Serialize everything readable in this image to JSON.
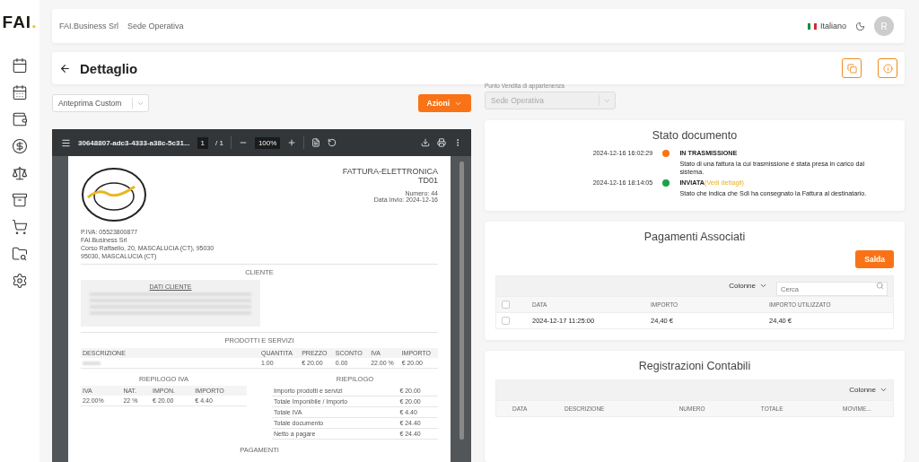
{
  "logo": {
    "text": "FAI",
    "dot": "."
  },
  "header": {
    "breadcrumbs": [
      "FAI.Business Srl",
      "Sede Operativa"
    ],
    "language": "Italiano",
    "avatar": "R"
  },
  "title": "Dettaglio",
  "preview_select": {
    "value": "Anteprima Custom"
  },
  "actions_button": "Azioni",
  "store_select": {
    "label": "Punto Vendita di appartenenza",
    "value": "Sede Operativa",
    "disabled": true
  },
  "pdf": {
    "file": "30648807-adc3-4333-a38c-5c31...",
    "page": "1",
    "pages": "/ 1",
    "zoom": "100%",
    "doc_type": "FATTURA-ELETTRONICA",
    "doc_code": "TD01",
    "number": "Numero: 44",
    "date": "Data Invio: 2024-12-16",
    "issuer": [
      "P.IVA: 05523800877",
      "FAI.Business Srl",
      "Corso Raffaello, 20, MASCALUCIA (CT), 95030",
      "95030, MASCALUCIA (CT)"
    ],
    "client_section": "CLIENTE",
    "client_title": "DATI CLIENTE",
    "products_section": "PRODOTTI E SERVIZI",
    "products_columns": [
      "DESCRIZIONE",
      "QUANTITA",
      "PREZZO",
      "SCONTO",
      "IVA",
      "IMPORTO"
    ],
    "products_rows": [
      [
        "1.00",
        "€ 20.00",
        "0.00",
        "22.00 %",
        "€ 20.00"
      ]
    ],
    "vat_section": "RIEPILOGO IVA",
    "vat_columns": [
      "IVA",
      "NAT.",
      "IMPON.",
      "IMPORTO"
    ],
    "vat_rows": [
      [
        "22.00%",
        "22 %",
        "€ 20.00",
        "€ 4.40"
      ]
    ],
    "summary_section": "RIEPILOGO",
    "summary_rows": [
      [
        "Importo prodotti e servizi",
        "€ 20.00"
      ],
      [
        "Totale Imponibile / Importo",
        "€ 20.00"
      ],
      [
        "Totale IVA",
        "€ 4.40"
      ],
      [
        "Totale documento",
        "€ 24.40"
      ],
      [
        "Netto a pagare",
        "€ 24.40"
      ]
    ],
    "payments_section": "PAGAMENTI"
  },
  "status": {
    "title": "Stato documento",
    "events": [
      {
        "time": "2024-12-16 16:02:29",
        "color": "#f97316",
        "title": "IN TRASMISSIONE",
        "description": "Stato di una fattura la cui trasmissione è stata presa in carico dal sistema."
      },
      {
        "time": "2024-12-16 18:14:05",
        "color": "#16a34a",
        "title": "INVIATA",
        "link": "(Vedi dettagli)",
        "description": "Stato che indica che SdI ha consegnato la Fattura al destinatario."
      }
    ]
  },
  "payments": {
    "title": "Pagamenti Associati",
    "button": "Salda",
    "columns_button": "Colonne",
    "search_placeholder": "Cerca",
    "select_all_checked": false,
    "columns": [
      "DATA",
      "IMPORTO",
      "IMPORTO UTILIZZATO"
    ],
    "rows": [
      {
        "checked": false,
        "cells": [
          "2024-12-17 11:25:00",
          "24,40 €",
          "24,40 €"
        ]
      }
    ]
  },
  "registrations": {
    "title": "Registrazioni Contabili",
    "columns_button": "Colonne",
    "columns": [
      "DATA",
      "DESCRIZIONE",
      "NUMERO",
      "TOTALE",
      "MOVIME..."
    ]
  }
}
